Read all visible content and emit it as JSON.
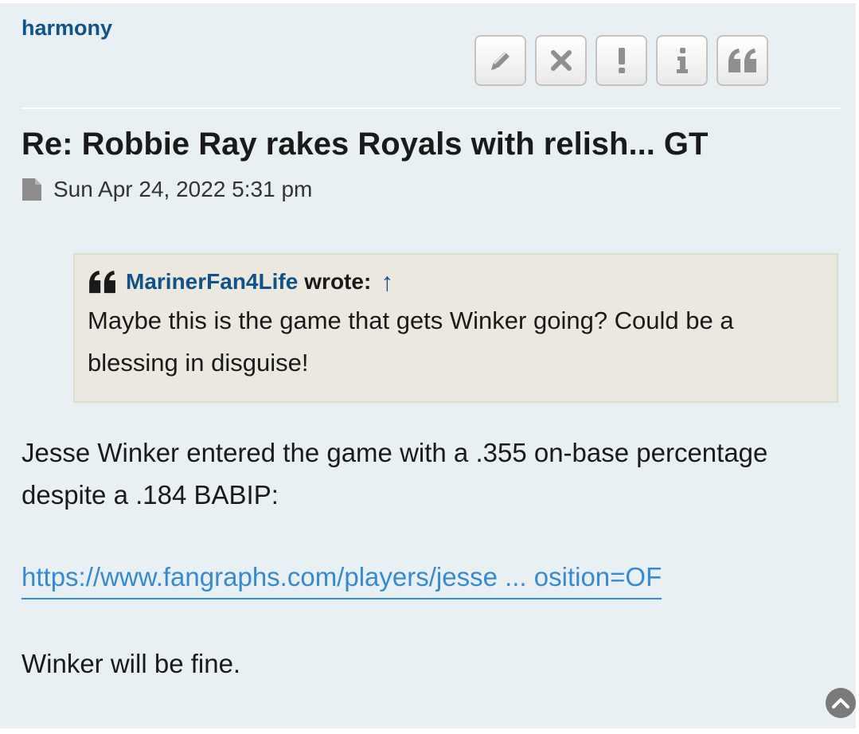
{
  "post": {
    "author": "harmony",
    "title": "Re: Robbie Ray rakes Royals with relish... GT",
    "date": "Sun Apr 24, 2022 5:31 pm"
  },
  "toolbar": {
    "buttons": [
      {
        "name": "edit",
        "icon": "pencil-icon"
      },
      {
        "name": "delete",
        "icon": "close-icon"
      },
      {
        "name": "report",
        "icon": "exclamation-icon"
      },
      {
        "name": "info",
        "icon": "info-icon"
      },
      {
        "name": "quote",
        "icon": "quote-icon"
      }
    ]
  },
  "quote": {
    "author": "MarinerFan4Life",
    "wrote": "wrote:",
    "arrow": "↑",
    "text": "Maybe this is the game that gets Winker going? Could be a blessing in disguise!"
  },
  "content": {
    "paragraph": "Jesse Winker entered the game with a .355 on-base percentage despite a .184 BABIP:",
    "link_text": "https://www.fangraphs.com/players/jesse ... osition=OF",
    "closing": "Winker will be fine."
  },
  "colors": {
    "post_background": "#e9f0f4",
    "link": "#368ad2",
    "author": "#105289",
    "quote_background": "#ebe9df"
  }
}
